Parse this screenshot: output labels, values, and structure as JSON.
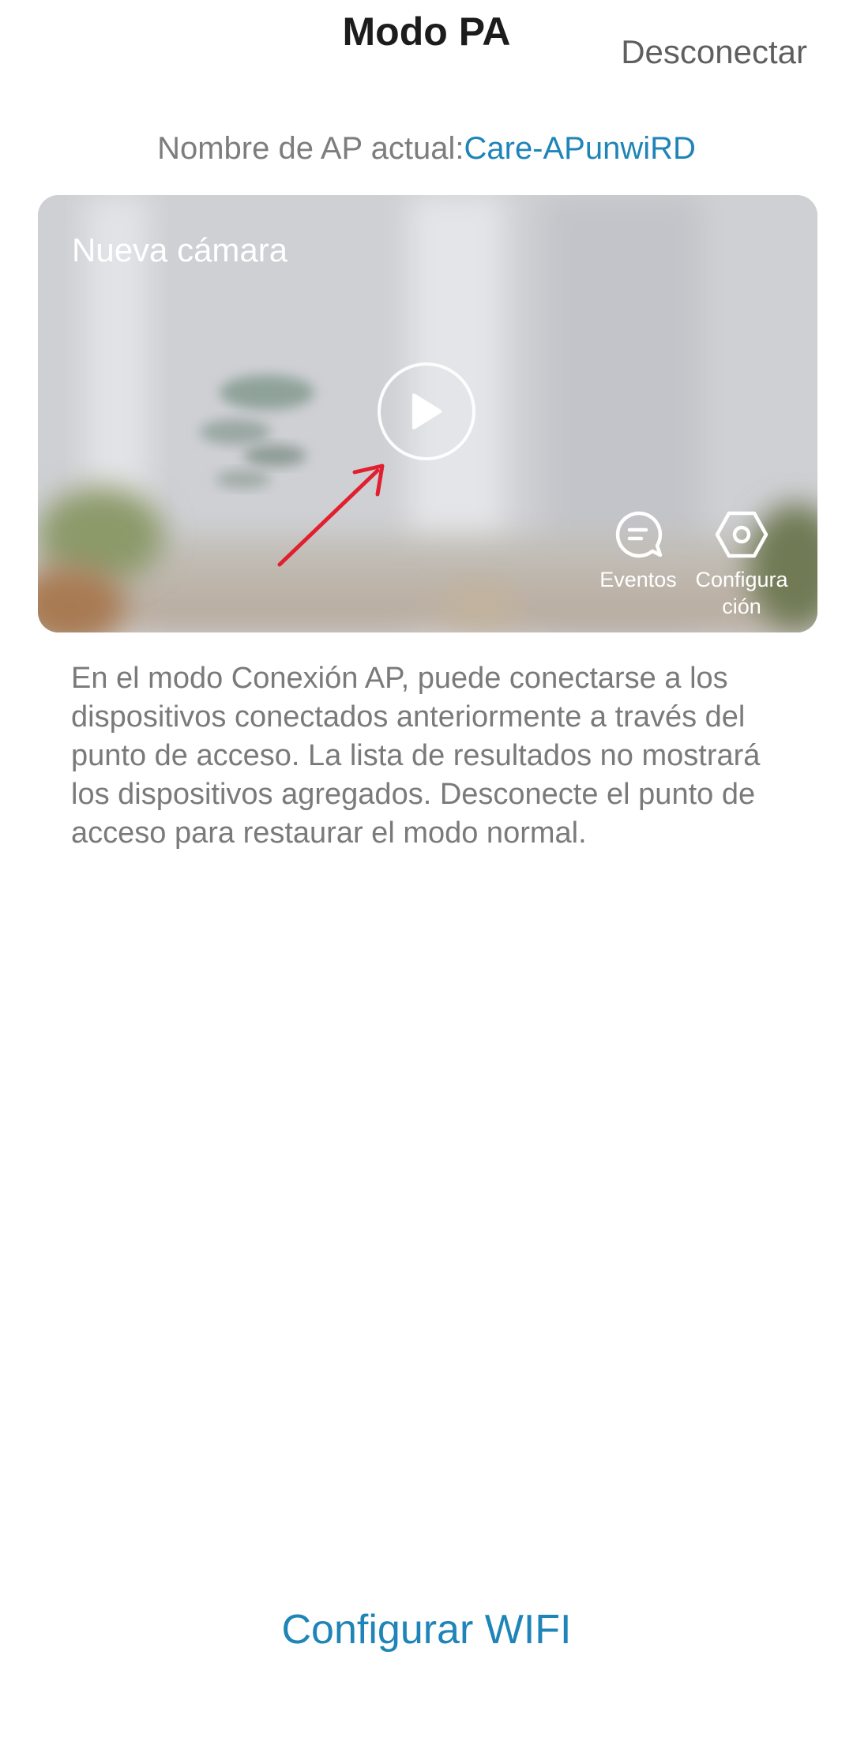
{
  "header": {
    "title": "Modo PA",
    "disconnect_label": "Desconectar"
  },
  "ap_info": {
    "label": "Nombre de AP actual:",
    "name": "Care-APunwiRD"
  },
  "camera": {
    "name": "Nueva cámara",
    "play_icon": "play-icon",
    "actions": [
      {
        "icon": "chat-bubble-icon",
        "label": "Eventos"
      },
      {
        "icon": "hexagon-settings-icon",
        "label": "Configuración"
      }
    ]
  },
  "description": "En el modo Conexión AP, puede conectarse a los dispositivos conectados anteriormente a través del punto de acceso. La lista de resultados no mostrará los dispositivos agregados. Desconecte el punto de acceso para restaurar el modo normal.",
  "footer": {
    "configure_wifi_label": "Configurar WIFI"
  },
  "colors": {
    "accent": "#1f84b8",
    "title_text": "#1c1c1c",
    "secondary_text": "#7a7a7a",
    "annotation_arrow": "#e0202f"
  }
}
